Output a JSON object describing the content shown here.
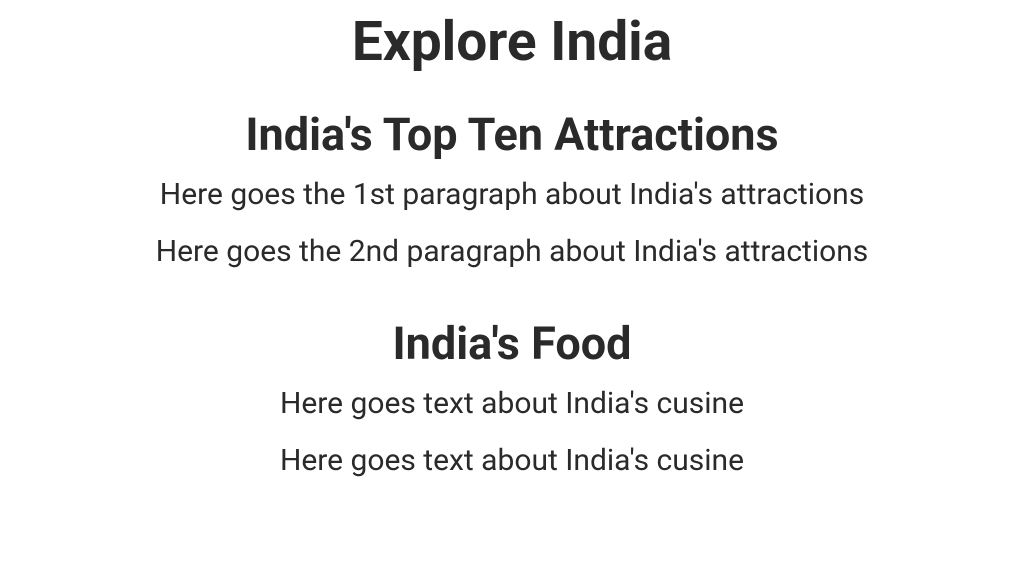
{
  "page": {
    "title": "Explore India",
    "sections": [
      {
        "heading": "India's Top Ten Attractions",
        "paragraphs": [
          "Here goes the 1st paragraph about India's attractions",
          "Here goes the 2nd paragraph about India's attractions"
        ]
      },
      {
        "heading": "India's Food",
        "paragraphs": [
          "Here goes text about India's cusine",
          "Here goes text about India's cusine"
        ]
      }
    ]
  }
}
